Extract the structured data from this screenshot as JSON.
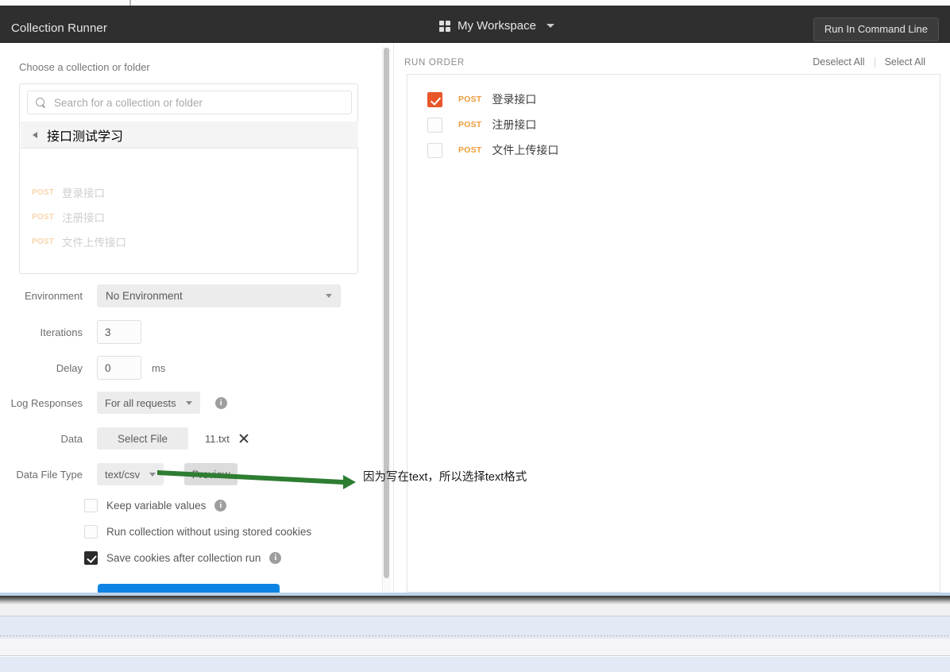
{
  "header": {
    "title": "Collection Runner",
    "workspace_name": "My Workspace",
    "workspace_icon": "grid-icon",
    "workspace_caret": "chevron-down-icon",
    "command_line_button": "Run In Command Line"
  },
  "left": {
    "choose_label": "Choose a collection or folder",
    "search": {
      "placeholder": "Search for a collection or folder",
      "value": "",
      "icon": "search-icon"
    },
    "collection": {
      "name": "接口测试学习",
      "toggle_icon": "triangle-left-icon",
      "requests": [
        {
          "method": "POST",
          "name": "登录接口"
        },
        {
          "method": "POST",
          "name": "注册接口"
        },
        {
          "method": "POST",
          "name": "文件上传接口"
        }
      ]
    },
    "form": {
      "environment_label": "Environment",
      "environment_value": "No Environment",
      "iterations_label": "Iterations",
      "iterations_value": "3",
      "delay_label": "Delay",
      "delay_value": "0",
      "delay_unit": "ms",
      "log_responses_label": "Log Responses",
      "log_responses_value": "For all requests",
      "data_label": "Data",
      "select_file_button": "Select File",
      "data_file_name": "11.txt",
      "remove_file_icon": "close-icon",
      "data_file_type_label": "Data File Type",
      "data_file_type_value": "text/csv",
      "preview_button": "Preview"
    },
    "options": [
      {
        "label": "Keep variable values",
        "checked": false,
        "has_info": true
      },
      {
        "label": "Run collection without using stored cookies",
        "checked": false,
        "has_info": false
      },
      {
        "label": "Save cookies after collection run",
        "checked": true,
        "has_info": true
      }
    ],
    "run_button_label": ""
  },
  "right": {
    "run_order_label": "RUN ORDER",
    "deselect_all": "Deselect All",
    "select_all": "Select All",
    "items": [
      {
        "method": "POST",
        "name": "登录接口",
        "checked": true
      },
      {
        "method": "POST",
        "name": "注册接口",
        "checked": false
      },
      {
        "method": "POST",
        "name": "文件上传接口",
        "checked": false
      }
    ]
  },
  "annotation": {
    "text": "因为写在text，所以选择text格式",
    "arrow_color": "#2e7d32"
  },
  "colors": {
    "header_bg": "#2f2f2f",
    "accent_orange": "#e8562a",
    "method_orange": "#ec9c3a",
    "run_button_blue": "#0d84e3"
  }
}
